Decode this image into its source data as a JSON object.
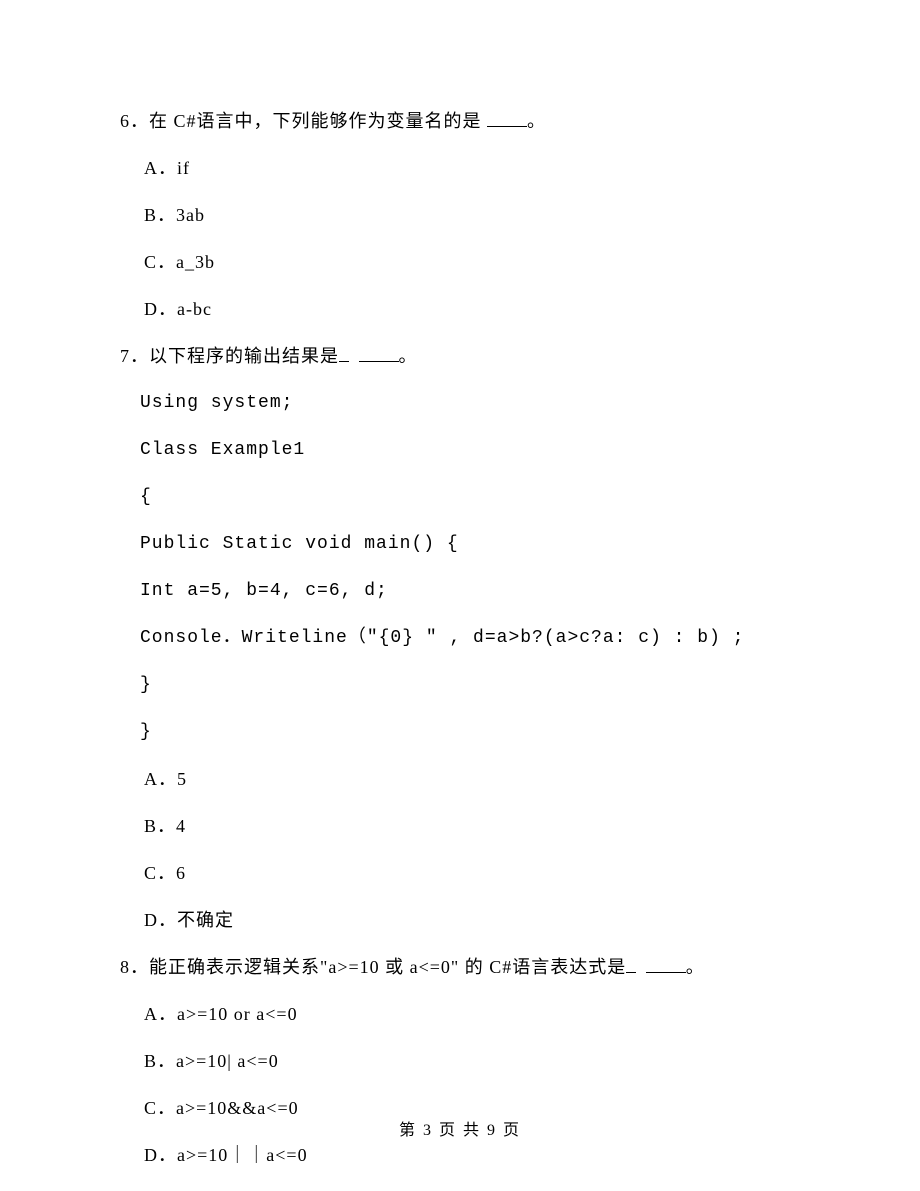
{
  "questions": {
    "q6": {
      "number": "6．",
      "stem_pre": "在 C#语言中，下列能够作为变量名的是 ",
      "stem_post": "。",
      "options": {
        "a": "A．if",
        "b": "B．3ab",
        "c": "C．a_3b",
        "d": "D．a-bc"
      }
    },
    "q7": {
      "number": "7．",
      "stem_pre": "以下程序的输出结果是",
      "stem_post": "。",
      "code": {
        "l1": "Using system;",
        "l2": "Class Example1",
        "l3": "{",
        "l4": "Public Static void main() {",
        "l5": "Int a=5, b=4, c=6, d;",
        "l6": "Console．Writeline（\"{0} \" , d=a>b?(a>c?a: c) : b) ;",
        "l7": "}",
        "l8": "}"
      },
      "options": {
        "a": "A．5",
        "b": "B．4",
        "c": "C．6",
        "d": "D．不确定"
      }
    },
    "q8": {
      "number": "8．",
      "stem_pre": "能正确表示逻辑关系\"a>=10 或 a<=0\" 的 C#语言表达式是",
      "stem_post": "。",
      "options": {
        "a": "A．a>=10 or a<=0",
        "b": "B．a>=10| a<=0",
        "c": "C．a>=10&&a<=0",
        "d": "D．a>=10｜｜a<=0"
      }
    }
  },
  "footer": {
    "text": "第 3 页 共 9 页"
  }
}
